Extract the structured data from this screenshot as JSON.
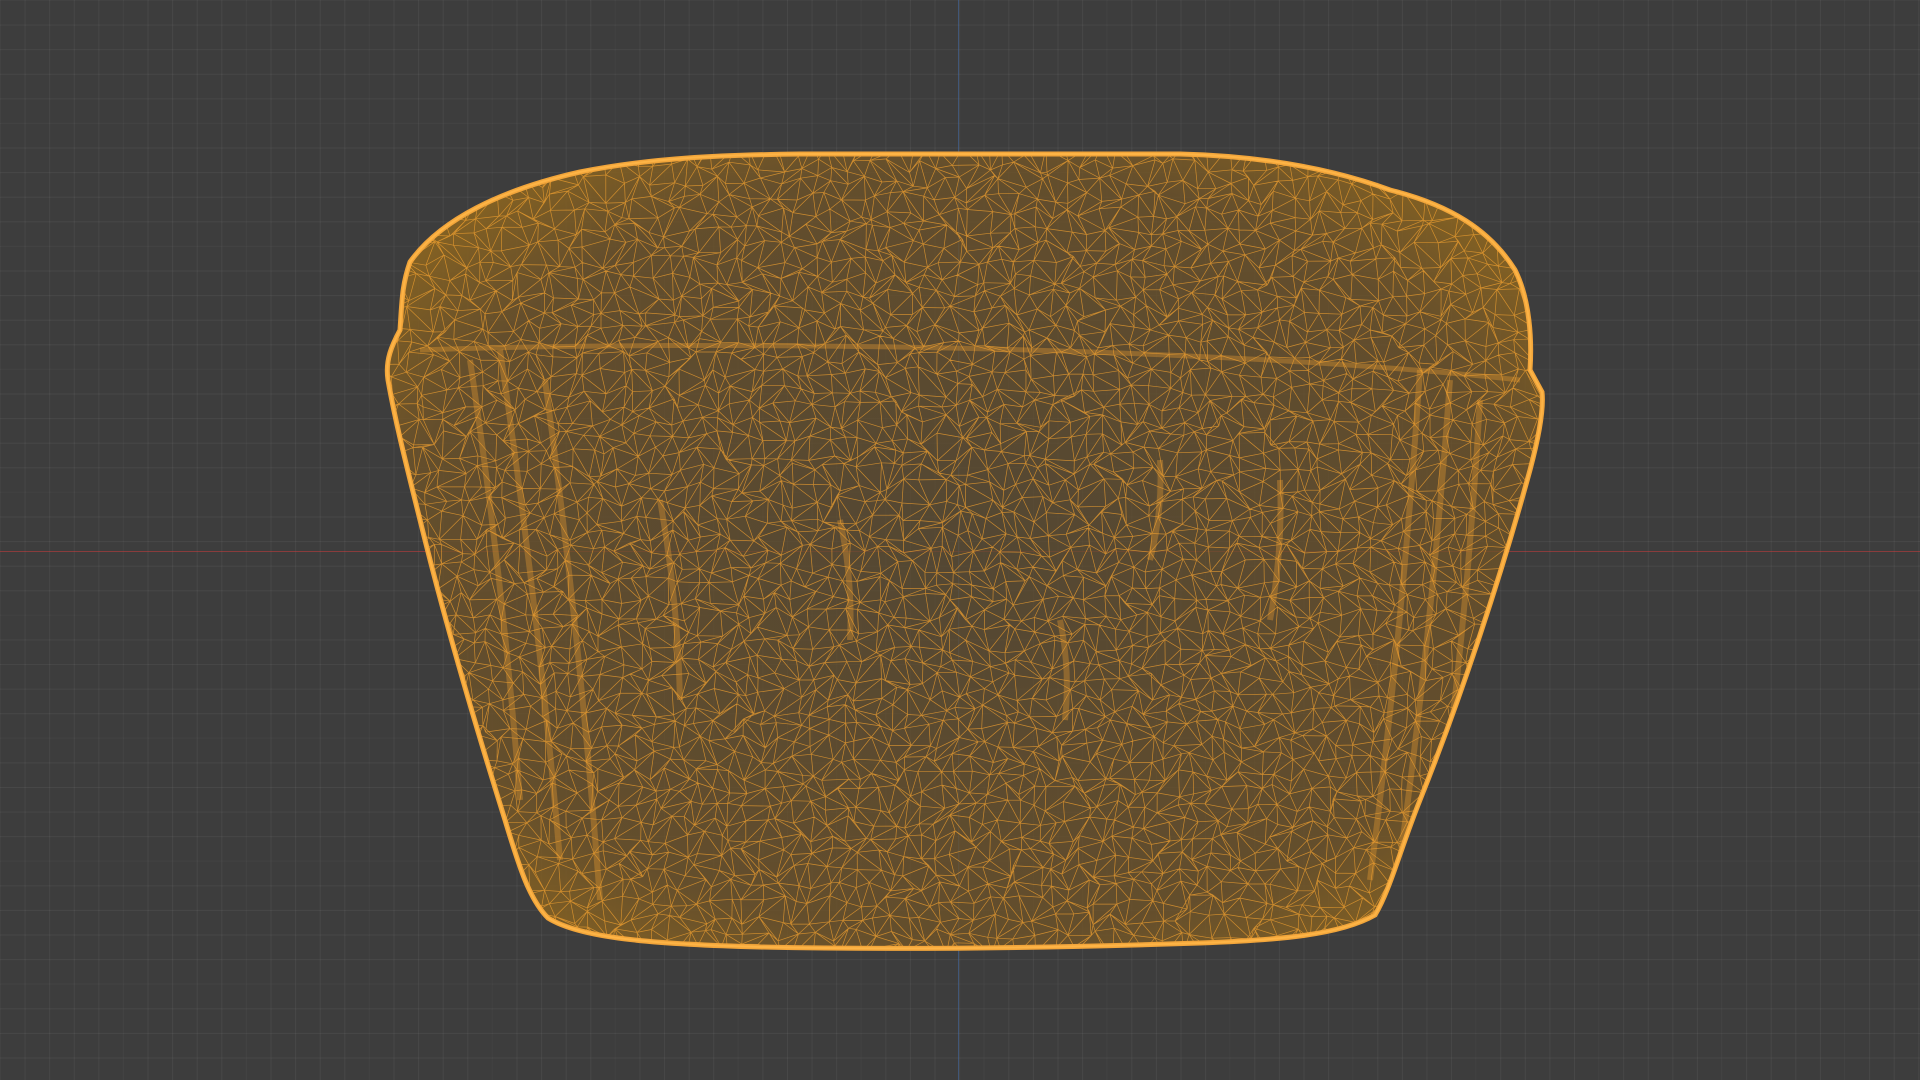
{
  "viewport": {
    "background_color": "#3d3d3d",
    "grid_color": "#474747",
    "x_axis_color": "#c83c3c",
    "y_axis_color": "#466eaa"
  },
  "mesh": {
    "display_mode": "wireframe",
    "selected": true,
    "wire_color": "#f0a030",
    "shape": "rounded-tapered-block"
  }
}
